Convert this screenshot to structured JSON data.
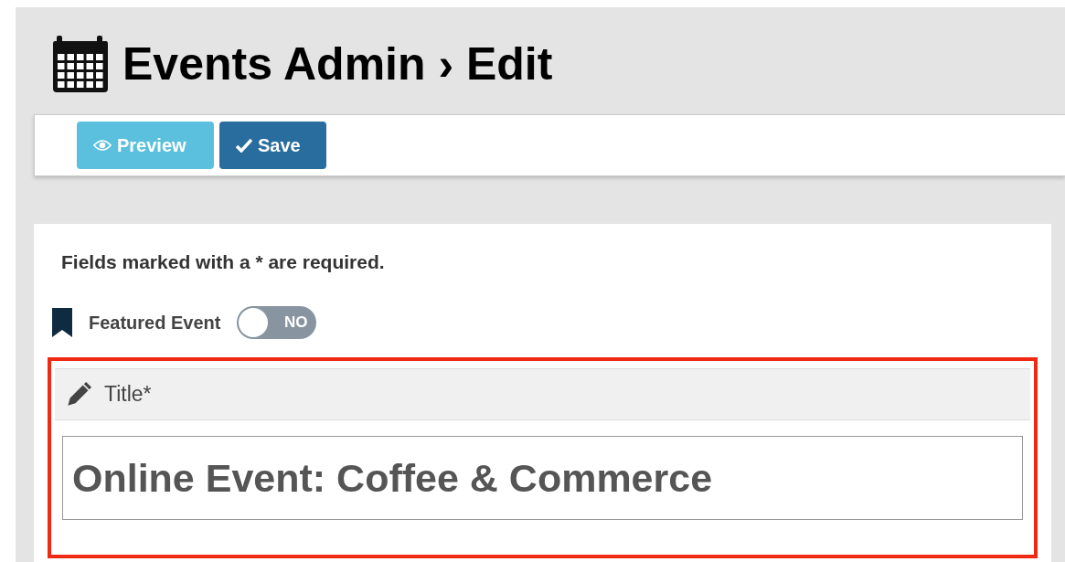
{
  "header": {
    "title": "Events Admin › Edit"
  },
  "toolbar": {
    "buttons": [
      {
        "kind": "preview",
        "label": "Preview"
      },
      {
        "kind": "save",
        "label": "Save"
      }
    ]
  },
  "form": {
    "note": "Fields marked with a * are required.",
    "featured": {
      "label": "Featured Event",
      "on": false,
      "state_label": "NO"
    },
    "title_field": {
      "label": "Title*",
      "value": "Online Event: Coffee & Commerce",
      "highlighted": true
    }
  }
}
